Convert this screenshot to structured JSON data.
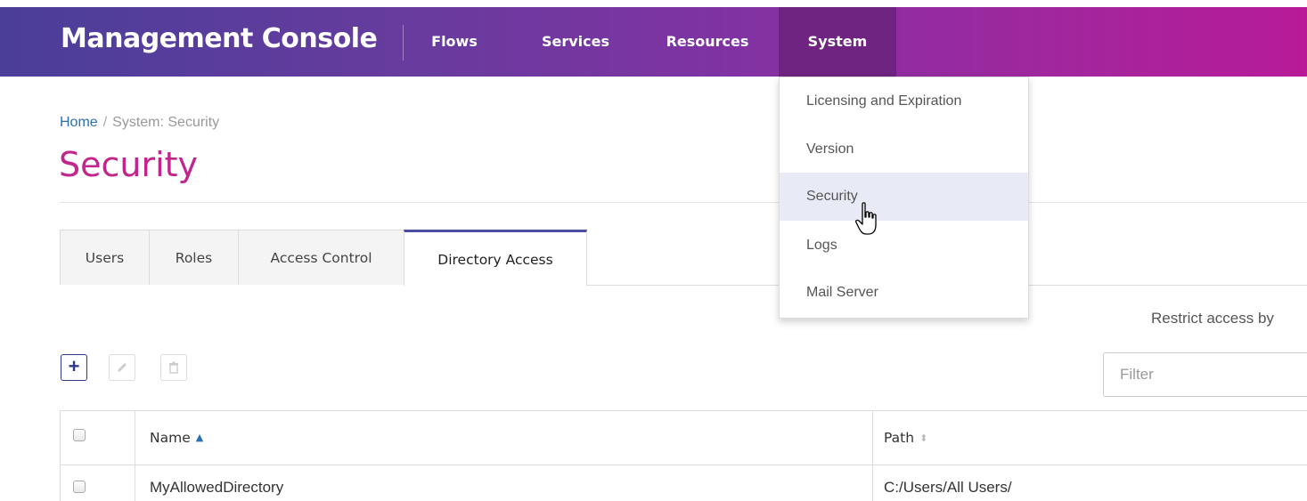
{
  "app": {
    "title": "Management Console"
  },
  "nav": {
    "items": [
      {
        "label": "Flows"
      },
      {
        "label": "Services"
      },
      {
        "label": "Resources"
      },
      {
        "label": "System"
      }
    ],
    "active": "System"
  },
  "system_menu": {
    "items": [
      {
        "label": "Licensing and Expiration"
      },
      {
        "label": "Version"
      },
      {
        "label": "Security"
      },
      {
        "label": "Logs"
      },
      {
        "label": "Mail Server"
      }
    ],
    "hovered": "Security"
  },
  "breadcrumb": {
    "home": "Home",
    "separator": "/",
    "current": "System: Security"
  },
  "page": {
    "title": "Security"
  },
  "tabs": {
    "items": [
      {
        "label": "Users"
      },
      {
        "label": "Roles"
      },
      {
        "label": "Access Control"
      },
      {
        "label": "Directory Access"
      }
    ],
    "active": "Directory Access"
  },
  "restrict_text": "Restrict access by",
  "toolbar": {
    "add_icon": "plus-icon",
    "edit_icon": "pencil-icon",
    "delete_icon": "trash-icon"
  },
  "filter": {
    "placeholder": "Filter",
    "value": ""
  },
  "table": {
    "columns": [
      {
        "label": "Name",
        "sort": "ascending"
      },
      {
        "label": "Path",
        "sort": "none"
      }
    ],
    "rows": [
      {
        "name": "MyAllowedDirectory",
        "path": "C:/Users/All Users/"
      }
    ]
  },
  "colors": {
    "accent_title": "#c2268d",
    "link": "#2a6fb8",
    "nav_gradient_start": "#4a3e99",
    "nav_gradient_end": "#b81a98",
    "active_tab_border": "#4a4ea0"
  }
}
